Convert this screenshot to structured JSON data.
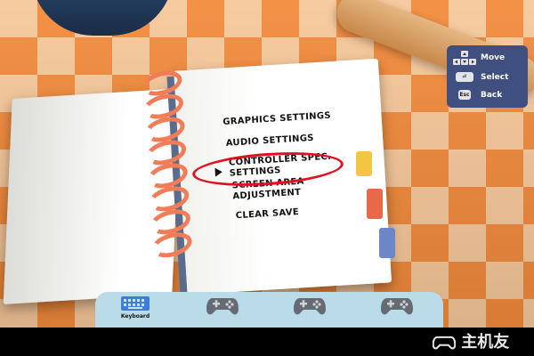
{
  "menu": {
    "items": [
      {
        "label": "GRAPHICS SETTINGS"
      },
      {
        "label": "AUDIO SETTINGS"
      },
      {
        "label": "CONTROLLER SPEC.",
        "label2": "SETTINGS"
      },
      {
        "label": "SCREEN AREA",
        "label2": "ADJUSTMENT"
      },
      {
        "label": "CLEAR SAVE"
      }
    ]
  },
  "controls": {
    "move_label": "Move",
    "select_label": "Select",
    "back_label": "Back",
    "back_key": "Esc"
  },
  "bottom_bar": {
    "keyboard_label": "Keyboard"
  },
  "watermark": {
    "text": "主机友"
  },
  "colors": {
    "highlight": "#e0101f",
    "panel": "#3f4f7f",
    "bar": "#b9dce8",
    "tile_orange": "#f28a3b",
    "tile_cream": "#f7c89a"
  }
}
